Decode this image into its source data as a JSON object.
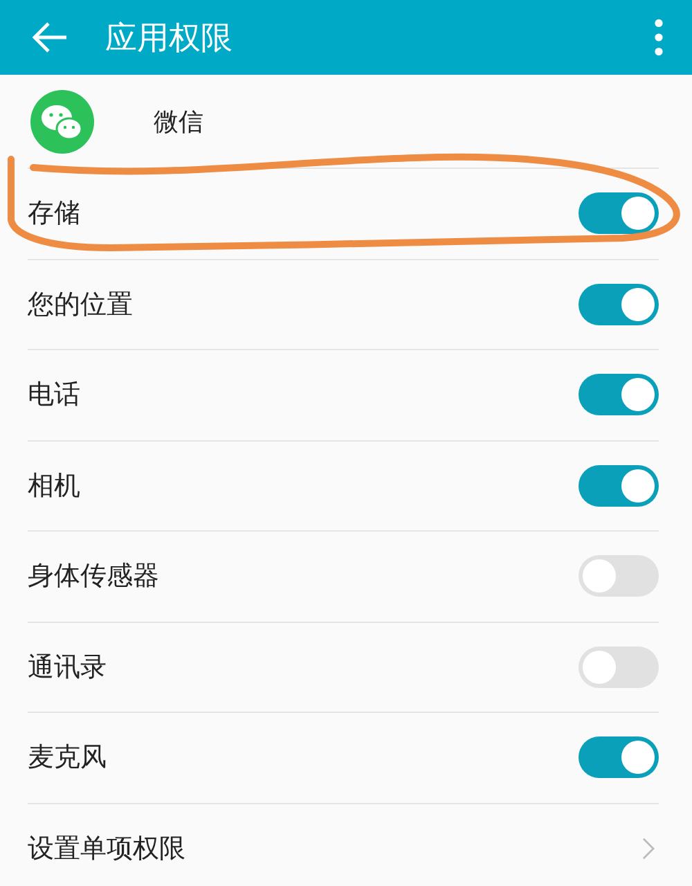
{
  "toolbar": {
    "title": "应用权限"
  },
  "app": {
    "name": "微信"
  },
  "permissions": [
    {
      "kind": "toggle",
      "label": "存储",
      "on": true,
      "circled": true
    },
    {
      "kind": "toggle",
      "label": "您的位置",
      "on": true,
      "circled": false
    },
    {
      "kind": "toggle",
      "label": "电话",
      "on": true,
      "circled": false
    },
    {
      "kind": "toggle",
      "label": "相机",
      "on": true,
      "circled": false
    },
    {
      "kind": "toggle",
      "label": "身体传感器",
      "on": false,
      "circled": false
    },
    {
      "kind": "toggle",
      "label": "通讯录",
      "on": false,
      "circled": false
    },
    {
      "kind": "toggle",
      "label": "麦克风",
      "on": true,
      "circled": false
    },
    {
      "kind": "link",
      "label": "设置单项权限",
      "circled": false
    }
  ]
}
